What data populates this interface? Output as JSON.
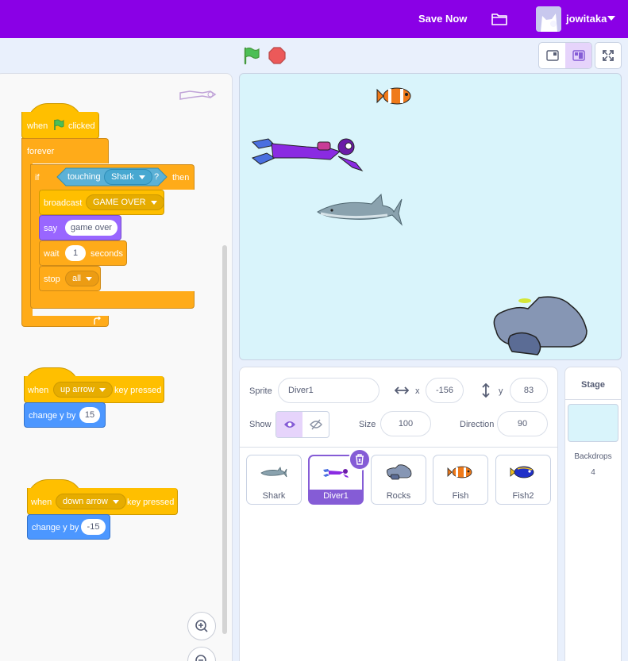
{
  "menu": {
    "save_now": "Save Now",
    "username": "jowitaka",
    "icons": [
      "folder-icon",
      "avatar",
      "chevron-down-icon"
    ]
  },
  "stage_header": {
    "icons": [
      "green-flag-icon",
      "stop-icon",
      "small-stage-icon",
      "normal-stage-icon",
      "fullscreen-icon"
    ]
  },
  "scripts": {
    "script1": {
      "hat_when": "when",
      "hat_clicked": "clicked",
      "forever": "forever",
      "if": "if",
      "touching": "touching",
      "touching_target": "Shark",
      "question": "?",
      "then": "then",
      "broadcast": "broadcast",
      "broadcast_msg": "GAME OVER",
      "say": "say",
      "say_text": "game over",
      "wait": "wait",
      "wait_value": "1",
      "seconds": "seconds",
      "stop": "stop",
      "stop_option": "all"
    },
    "script2": {
      "when": "when",
      "key": "up arrow",
      "key_pressed": "key pressed",
      "change_y": "change y by",
      "value": "15"
    },
    "script3": {
      "when": "when",
      "key": "down arrow",
      "key_pressed": "key pressed",
      "change_y": "change y by",
      "value": "-15"
    }
  },
  "sprite_info": {
    "sprite_label": "Sprite",
    "sprite_name": "Diver1",
    "x_label": "x",
    "x_value": "-156",
    "y_label": "y",
    "y_value": "83",
    "show_label": "Show",
    "size_label": "Size",
    "size_value": "100",
    "direction_label": "Direction",
    "direction_value": "90"
  },
  "sprites": [
    {
      "name": "Shark",
      "selected": false
    },
    {
      "name": "Diver1",
      "selected": true
    },
    {
      "name": "Rocks",
      "selected": false
    },
    {
      "name": "Fish",
      "selected": false
    },
    {
      "name": "Fish2",
      "selected": false
    }
  ],
  "stage_pane": {
    "title": "Stage",
    "backdrops_label": "Backdrops",
    "backdrops_count": "4"
  },
  "colors": {
    "menu_bar": "#8a00e6",
    "events": "#ffbf00",
    "control": "#ffab19",
    "looks": "#9966ff",
    "motion": "#4c97ff",
    "sensing": "#5cb1d6",
    "selected": "#855cd6",
    "stage_bg": "#d9f4fb"
  }
}
